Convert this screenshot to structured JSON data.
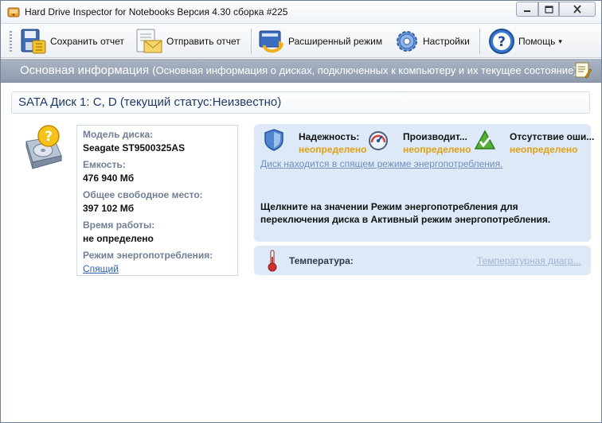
{
  "window": {
    "title": "Hard Drive Inspector for Notebooks Версия 4.30 сборка #225"
  },
  "toolbar": {
    "save_label": "Сохранить отчет",
    "send_label": "Отправить отчет",
    "advanced_label": "Расширенный режим",
    "settings_label": "Настройки",
    "help_label": "Помощь",
    "help_arrow": "▾"
  },
  "info_header": {
    "title": "Основная информация",
    "subtitle": "(Основная информация о дисках, подключенных к компьютеру и  их текущее состояние)"
  },
  "disk": {
    "title": "SATA Диск 1: C, D (текущий статус:Неизвестно)",
    "properties": [
      {
        "label": "Модель диска:",
        "value": "Seagate ST9500325AS"
      },
      {
        "label": "Емкость:",
        "value": "476 940 Мб"
      },
      {
        "label": "Общее свободное место:",
        "value": "397 102 Мб"
      },
      {
        "label": "Время работы:",
        "value": "не определено"
      }
    ],
    "power_mode": {
      "label": "Режим энергопотребления:",
      "value": "Спящий"
    }
  },
  "status": {
    "items": [
      {
        "label": "Надежность:",
        "value": "неопределено",
        "icon": "shield-icon"
      },
      {
        "label": "Производит...",
        "value": "неопределено",
        "icon": "gauge-icon"
      },
      {
        "label": "Отсутствие оши...",
        "value": "неопределено",
        "icon": "check-triangle-icon"
      }
    ],
    "sleep_link": "Диск находится в спящем режиме энергопотребления.",
    "hint": "Щелкните на значении Режим энергопотребления для переключения диска в Активный режим энергопотребления."
  },
  "temperature": {
    "label": "Температура:",
    "link": "Температурная диагр..."
  },
  "colors": {
    "accent_value": "#e0a010",
    "link": "#2f64b4",
    "panel_bg": "#dde9f7",
    "header_bg": "#9aa6b8"
  }
}
